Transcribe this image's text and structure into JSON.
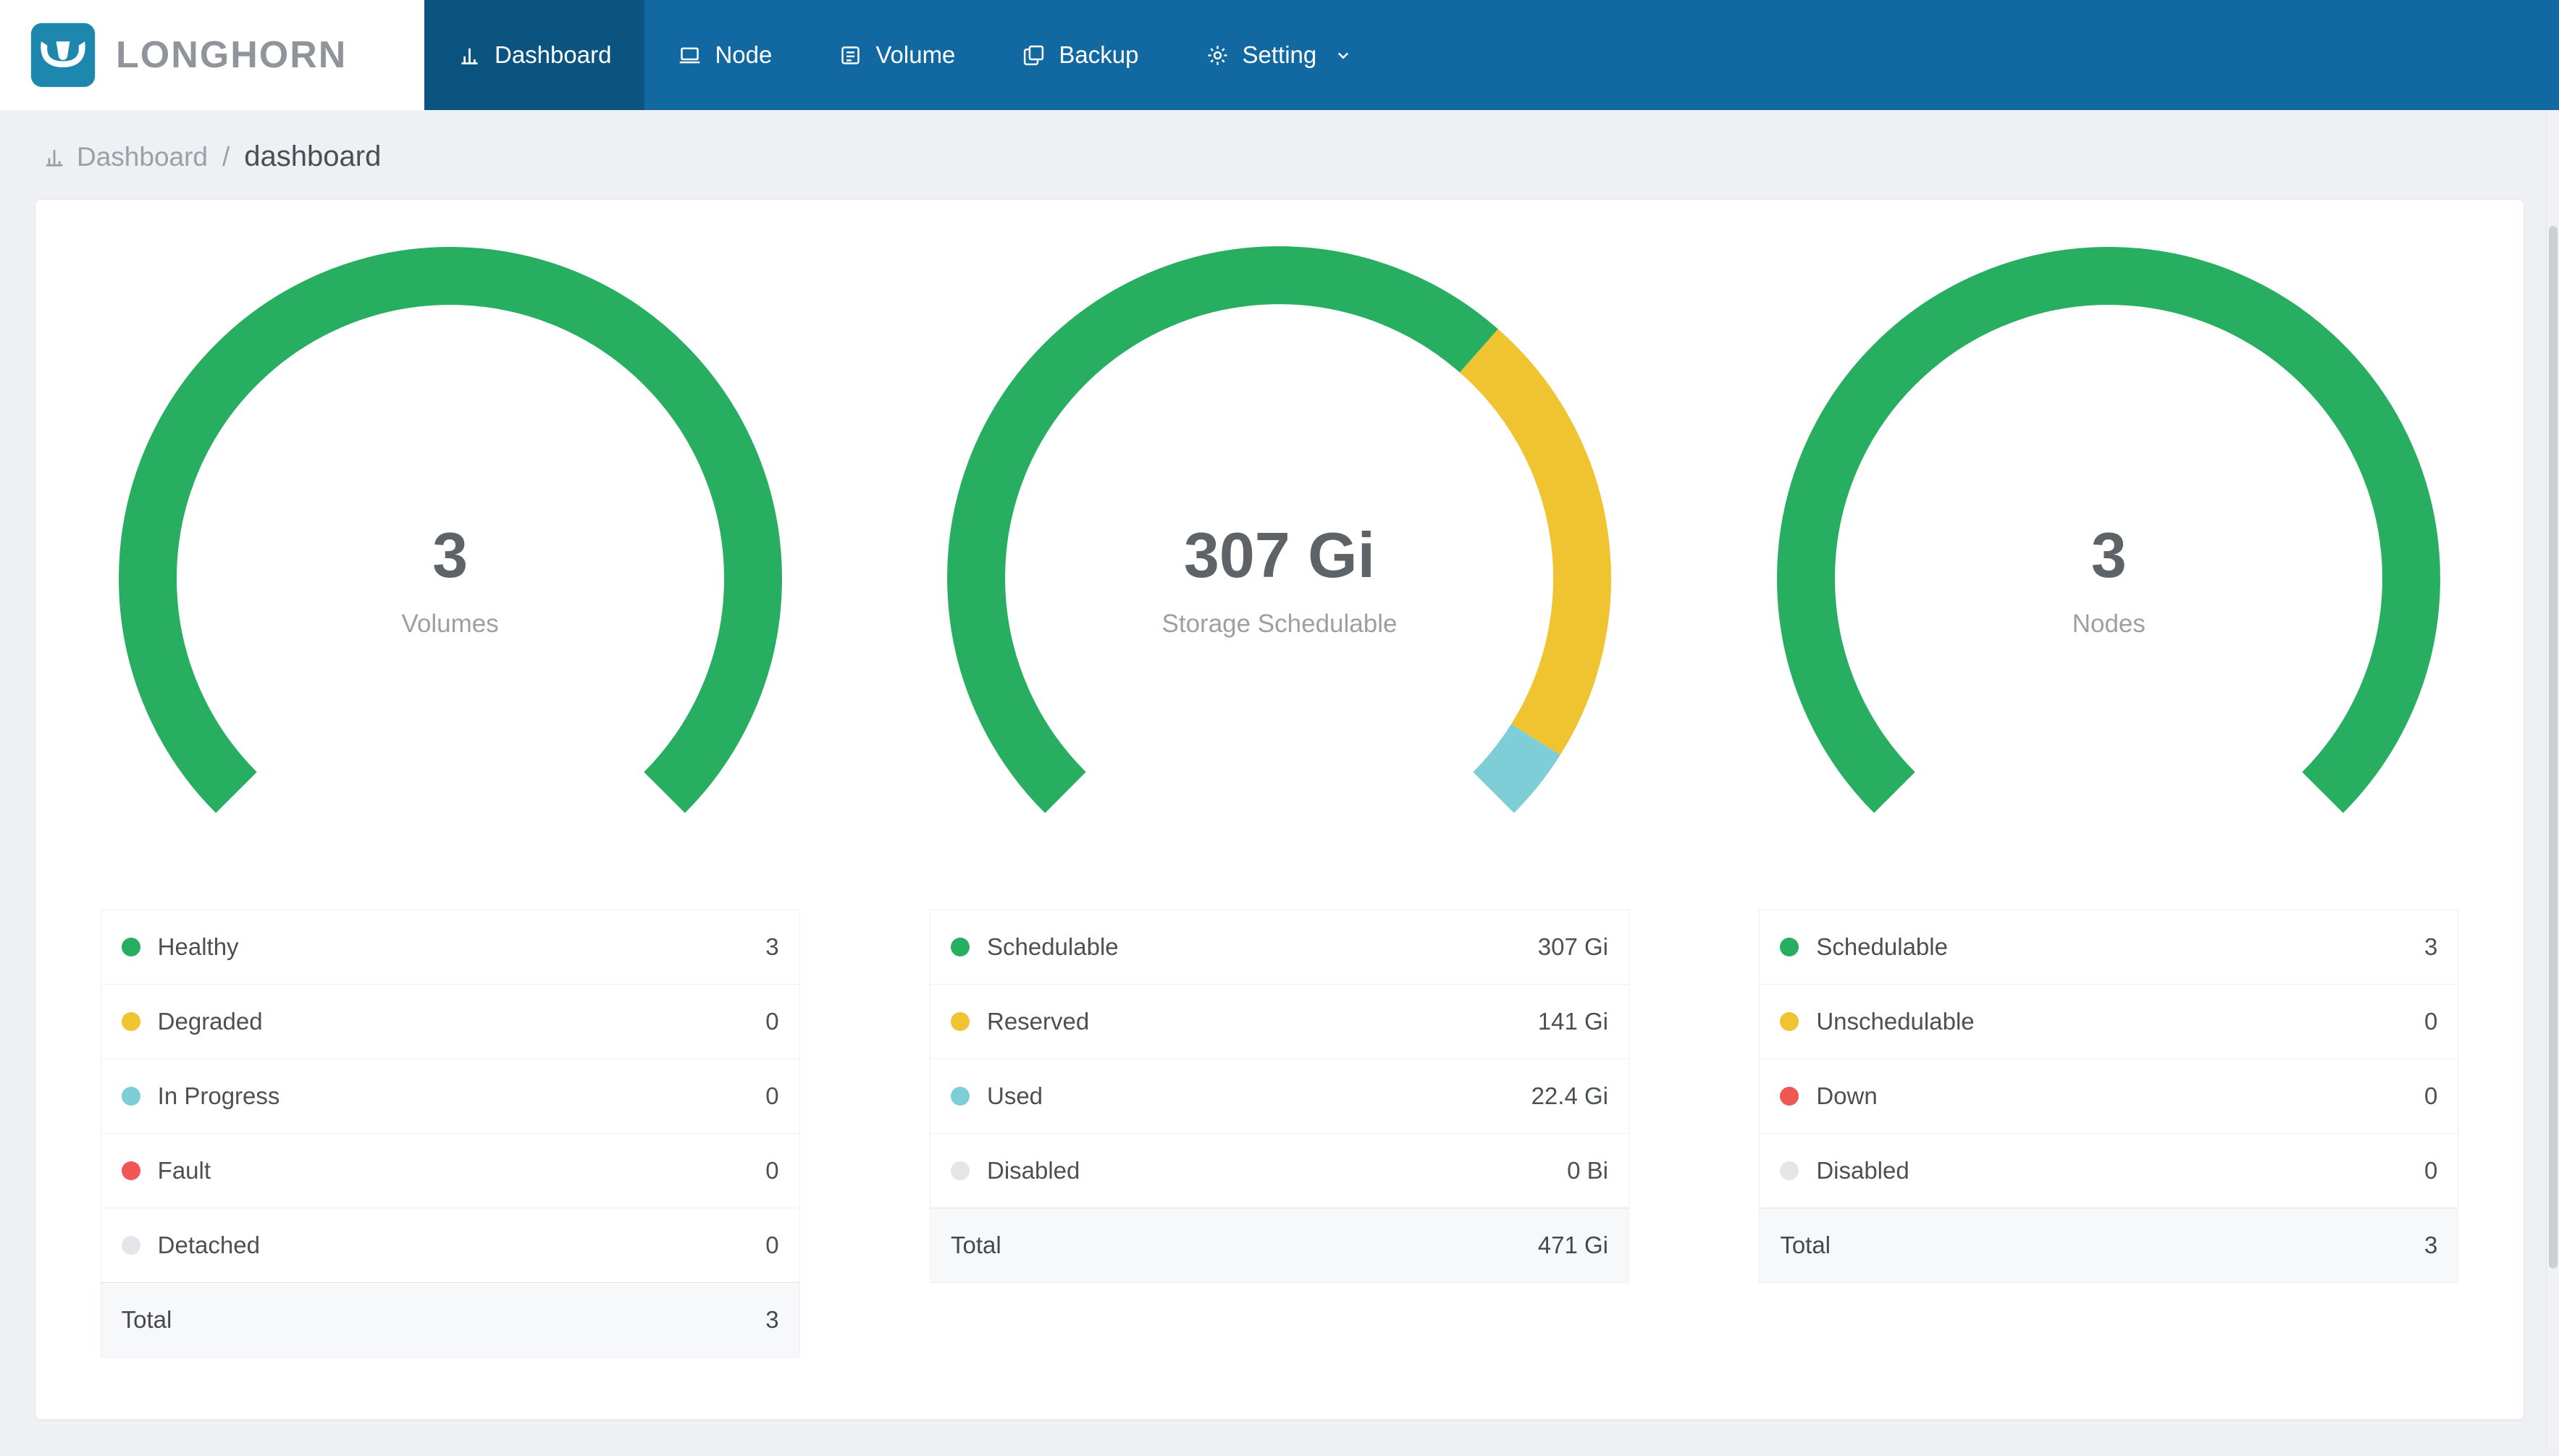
{
  "app": {
    "brand": "LONGHORN"
  },
  "nav": {
    "items": [
      {
        "label": "Dashboard",
        "active": true
      },
      {
        "label": "Node",
        "active": false
      },
      {
        "label": "Volume",
        "active": false
      },
      {
        "label": "Backup",
        "active": false
      },
      {
        "label": "Setting",
        "active": false,
        "has_dropdown": true
      }
    ]
  },
  "breadcrumb": {
    "root": "Dashboard",
    "separator": "/",
    "current": "dashboard"
  },
  "colors": {
    "navbar": "#1269A1",
    "navbar_active": "#0C5480",
    "green": "#27AE60",
    "yellow": "#F0C330",
    "teal": "#7DCED6",
    "red": "#F05654",
    "light_gray": "#E3E6E9"
  },
  "chart_data": [
    {
      "type": "gauge",
      "arc_degrees": 270,
      "center_value": "3",
      "center_label": "Volumes",
      "segments": [
        {
          "label": "Healthy",
          "value": 3,
          "color": "#27AE60"
        },
        {
          "label": "Degraded",
          "value": 0,
          "color": "#F0C330"
        },
        {
          "label": "In Progress",
          "value": 0,
          "color": "#7DCED6"
        },
        {
          "label": "Fault",
          "value": 0,
          "color": "#F05654"
        },
        {
          "label": "Detached",
          "value": 0,
          "color": "#E3E6E9"
        }
      ],
      "legend": {
        "rows": [
          {
            "label": "Healthy",
            "value": "3",
            "color": "#27AE60"
          },
          {
            "label": "Degraded",
            "value": "0",
            "color": "#F0C330"
          },
          {
            "label": "In Progress",
            "value": "0",
            "color": "#7DCED6"
          },
          {
            "label": "Fault",
            "value": "0",
            "color": "#F05654"
          },
          {
            "label": "Detached",
            "value": "0",
            "color": "#E3E6E9"
          }
        ],
        "total": {
          "label": "Total",
          "value": "3"
        }
      }
    },
    {
      "type": "gauge",
      "arc_degrees": 270,
      "center_value": "307 Gi",
      "center_label": "Storage Schedulable",
      "segments": [
        {
          "label": "Schedulable",
          "value": 307,
          "color": "#27AE60"
        },
        {
          "label": "Reserved",
          "value": 141,
          "color": "#F0C330"
        },
        {
          "label": "Used",
          "value": 22.4,
          "color": "#7DCED6"
        },
        {
          "label": "Disabled",
          "value": 0,
          "color": "#E3E6E9"
        }
      ],
      "legend": {
        "rows": [
          {
            "label": "Schedulable",
            "value": "307 Gi",
            "color": "#27AE60"
          },
          {
            "label": "Reserved",
            "value": "141 Gi",
            "color": "#F0C330"
          },
          {
            "label": "Used",
            "value": "22.4 Gi",
            "color": "#7DCED6"
          },
          {
            "label": "Disabled",
            "value": "0 Bi",
            "color": "#E3E6E9"
          }
        ],
        "total": {
          "label": "Total",
          "value": "471 Gi"
        }
      }
    },
    {
      "type": "gauge",
      "arc_degrees": 270,
      "center_value": "3",
      "center_label": "Nodes",
      "segments": [
        {
          "label": "Schedulable",
          "value": 3,
          "color": "#27AE60"
        },
        {
          "label": "Unschedulable",
          "value": 0,
          "color": "#F0C330"
        },
        {
          "label": "Down",
          "value": 0,
          "color": "#F05654"
        },
        {
          "label": "Disabled",
          "value": 0,
          "color": "#E3E6E9"
        }
      ],
      "legend": {
        "rows": [
          {
            "label": "Schedulable",
            "value": "3",
            "color": "#27AE60"
          },
          {
            "label": "Unschedulable",
            "value": "0",
            "color": "#F0C330"
          },
          {
            "label": "Down",
            "value": "0",
            "color": "#F05654"
          },
          {
            "label": "Disabled",
            "value": "0",
            "color": "#E3E6E9"
          }
        ],
        "total": {
          "label": "Total",
          "value": "3"
        }
      }
    }
  ]
}
